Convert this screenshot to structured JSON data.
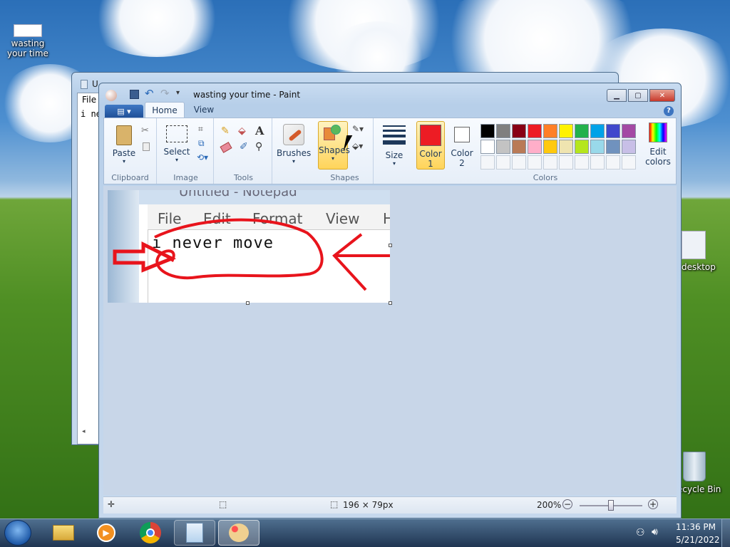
{
  "desktop": {
    "icons": [
      {
        "label": "wasting your time"
      },
      {
        "label": "desktop"
      },
      {
        "label": "ecycle Bin"
      }
    ]
  },
  "notepad_bg": {
    "title": "U",
    "menu_file": "File",
    "content": "i ne"
  },
  "paint": {
    "title": "wasting your time - Paint",
    "tabs": {
      "home": "Home",
      "view": "View"
    },
    "groups": {
      "clipboard": {
        "label": "Clipboard",
        "paste": "Paste"
      },
      "image": {
        "label": "Image",
        "select": "Select"
      },
      "tools": {
        "label": "Tools"
      },
      "brushes": {
        "label": "Brushes"
      },
      "shapes": {
        "label": "Shapes",
        "button": "Shapes"
      },
      "size": {
        "label": "Size"
      },
      "colors": {
        "label": "Colors",
        "color1": "Color\n1",
        "color1_a": "Color",
        "color1_b": "1",
        "color2_a": "Color",
        "color2_b": "2",
        "edit_a": "Edit",
        "edit_b": "colors",
        "primary": "#ed1c24",
        "secondary": "#ffffff",
        "palette_row1": [
          "#000000",
          "#7f7f7f",
          "#880015",
          "#ed1c24",
          "#ff7f27",
          "#fff200",
          "#22b14c",
          "#00a2e8",
          "#3f48cc",
          "#a349a4"
        ],
        "palette_row2": [
          "#ffffff",
          "#c3c3c3",
          "#b97a57",
          "#ffaec9",
          "#ffc90e",
          "#efe4b0",
          "#b5e61d",
          "#99d9ea",
          "#7092be",
          "#c8bfe7"
        ]
      }
    },
    "canvas_image": {
      "notepad_title": "Untitled - Notepad",
      "menu": [
        "File",
        "Edit",
        "Format",
        "View",
        "H"
      ],
      "text": "i never move"
    },
    "status": {
      "selection_size": "196 × 79px",
      "zoom": "200%",
      "zoom_fraction": 0.5
    }
  },
  "taskbar": {
    "time": "11:36 PM",
    "date": "5/21/2022"
  }
}
